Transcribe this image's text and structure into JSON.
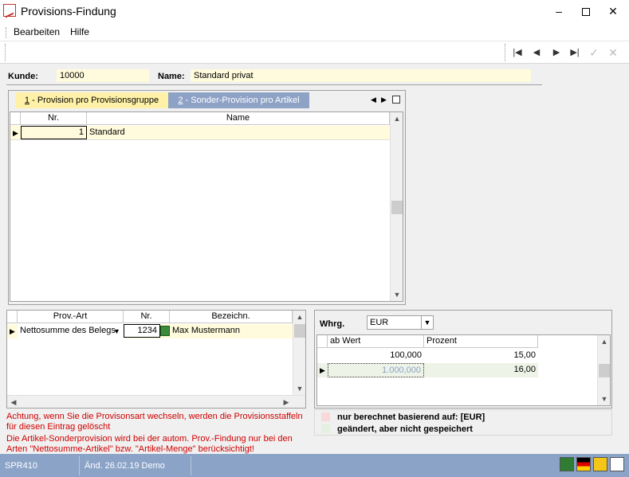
{
  "window": {
    "title": "Provisions-Findung"
  },
  "menu": {
    "bearbeiten": "Bearbeiten",
    "hilfe": "Hilfe"
  },
  "customer": {
    "kunde_label": "Kunde:",
    "kunde_value": "10000",
    "name_label": "Name:",
    "name_value": "Standard privat"
  },
  "tabs": [
    {
      "num": "1",
      "label": " - Provision pro Provisionsgruppe"
    },
    {
      "num": "2",
      "label": " - Sonder-Provision pro Artikel"
    }
  ],
  "group_table": {
    "headers": [
      "Nr.",
      "Name"
    ],
    "rows": [
      {
        "nr": "1",
        "name": "Standard"
      }
    ]
  },
  "prov_table": {
    "headers": [
      "Prov.-Art",
      "Nr.",
      "Bezeichn."
    ],
    "rows": [
      {
        "art": "Nettosumme des Belegs",
        "nr": "1234",
        "bez": "Max Mustermann"
      }
    ]
  },
  "currency": {
    "label": "Whrg.",
    "value": "EUR"
  },
  "staffel_table": {
    "headers": [
      "ab Wert",
      "Prozent"
    ],
    "rows": [
      {
        "ab": "100,000",
        "pct": "15,00"
      },
      {
        "ab": "1.000,000",
        "pct": "16,00"
      }
    ]
  },
  "legend": {
    "computed": "nur berechnet basierend auf:  [EUR]",
    "changed": "geändert, aber nicht gespeichert"
  },
  "warnings": {
    "line1": "Achtung, wenn Sie die Provisonsart wechseln, werden die Provisionsstaffeln",
    "line2": "für diesen Eintrag gelöscht",
    "line3": "Die Artikel-Sonderprovision wird bei der autom. Prov.-Findung nur bei den",
    "line4": "Arten \"Nettosumme-Artikel\" bzw. \"Artikel-Menge\" berücksichtigt!"
  },
  "status": {
    "module": "SPR410",
    "changed": "Änd. 26.02.19 Demo"
  },
  "colors": {
    "field_bg": "#fffbdc",
    "status_bg": "#8aa3c7",
    "tab_active": "#fff2a8",
    "tab_inactive": "#8ea2c6",
    "warn": "#d00000"
  }
}
